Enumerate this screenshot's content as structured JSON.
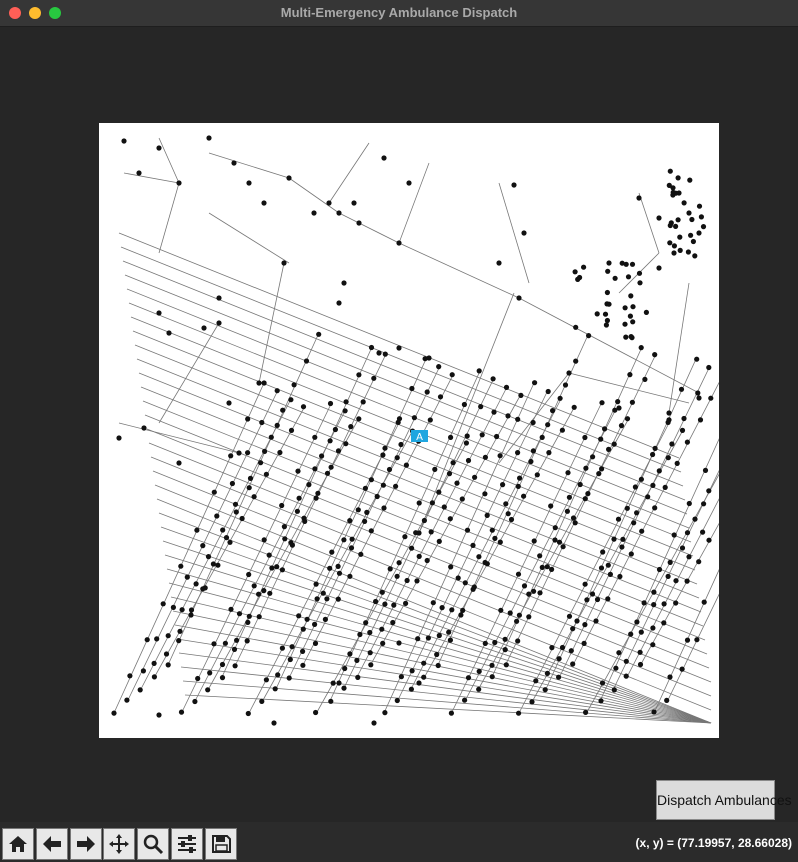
{
  "window": {
    "title": "Multi-Emergency Ambulance Dispatch"
  },
  "map": {
    "marker_label": "A",
    "marker_color": "#1fa6e0",
    "node_color": "#111111",
    "edge_color": "#777777"
  },
  "controls": {
    "dispatch_label": "Dispatch Ambulances"
  },
  "toolbar": {
    "tools": [
      "home-icon",
      "back-arrow-icon",
      "forward-arrow-icon",
      "pan-icon",
      "zoom-icon",
      "configure-subplots-icon",
      "save-icon"
    ]
  },
  "status": {
    "coords": "(x, y) = (77.19957, 28.66028)"
  }
}
